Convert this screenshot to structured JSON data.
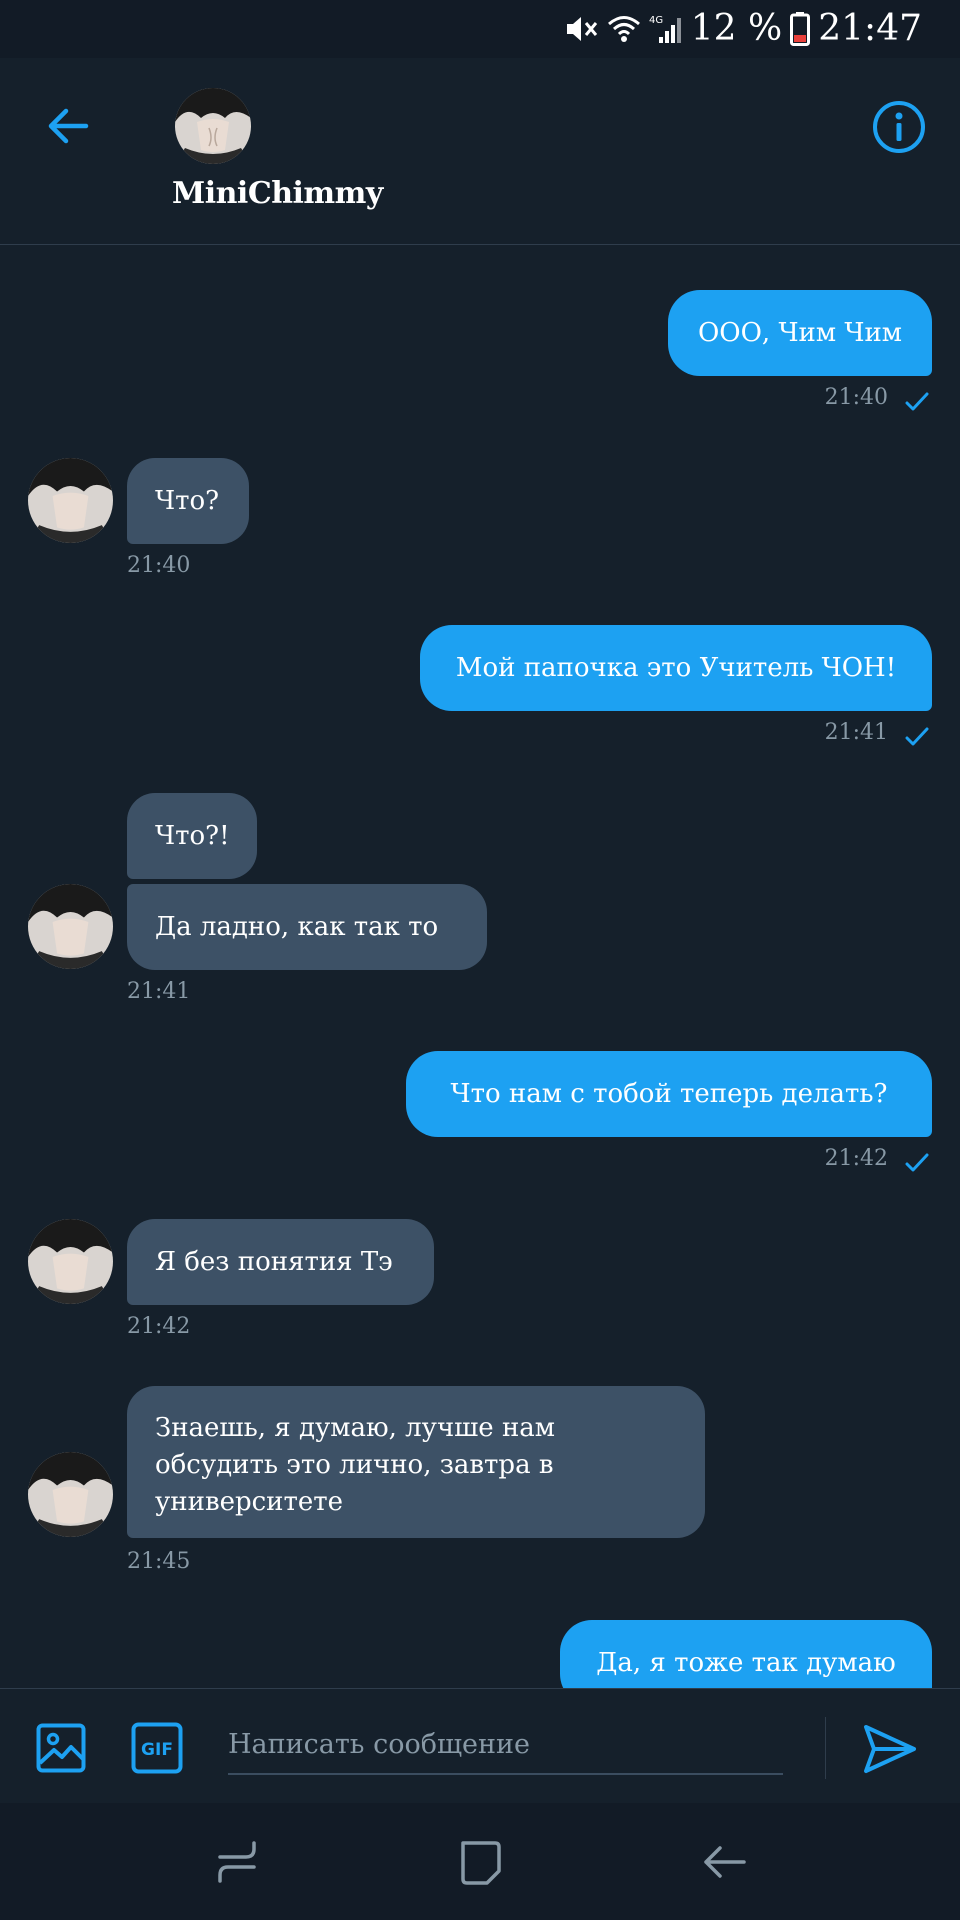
{
  "status_bar": {
    "battery": "12 %",
    "time": "21:47",
    "icons": [
      "mute-icon",
      "wifi-icon",
      "signal-4g-icon",
      "battery-icon"
    ]
  },
  "header": {
    "contact_name": "MiniChimmy",
    "icons": [
      "back-arrow-icon",
      "info-icon"
    ]
  },
  "messages": [
    {
      "direction": "out",
      "text": "ООО, Чим Чим",
      "time": "21:40"
    },
    {
      "direction": "in",
      "text": "Что?",
      "time": "21:40"
    },
    {
      "direction": "out",
      "text": "Мой папочка это Учитель ЧОН!",
      "time": "21:41"
    },
    {
      "direction": "in",
      "text": "Что?!"
    },
    {
      "direction": "in",
      "text": "Да ладно, как так то",
      "time": "21:41"
    },
    {
      "direction": "out",
      "text": "Что нам с тобой теперь делать?",
      "time": "21:42"
    },
    {
      "direction": "in",
      "text": "Я без понятия Тэ",
      "time": "21:42"
    },
    {
      "direction": "in",
      "text": "Знаешь, я думаю, лучше нам обсудить это лично, завтра в университете",
      "time": "21:45"
    },
    {
      "direction": "out",
      "text": "Да, я тоже так думаю"
    }
  ],
  "composer": {
    "placeholder": "Написать сообщение",
    "gif_label": "GIF",
    "icons": [
      "image-icon",
      "gif-icon",
      "send-icon"
    ]
  },
  "nav_bar": {
    "icons": [
      "recent-apps-icon",
      "home-icon",
      "back-icon"
    ]
  },
  "colors": {
    "background": "#15202b",
    "accent": "#1da1f2",
    "incoming_bubble": "#3d5166",
    "muted_text": "#8899a6"
  }
}
